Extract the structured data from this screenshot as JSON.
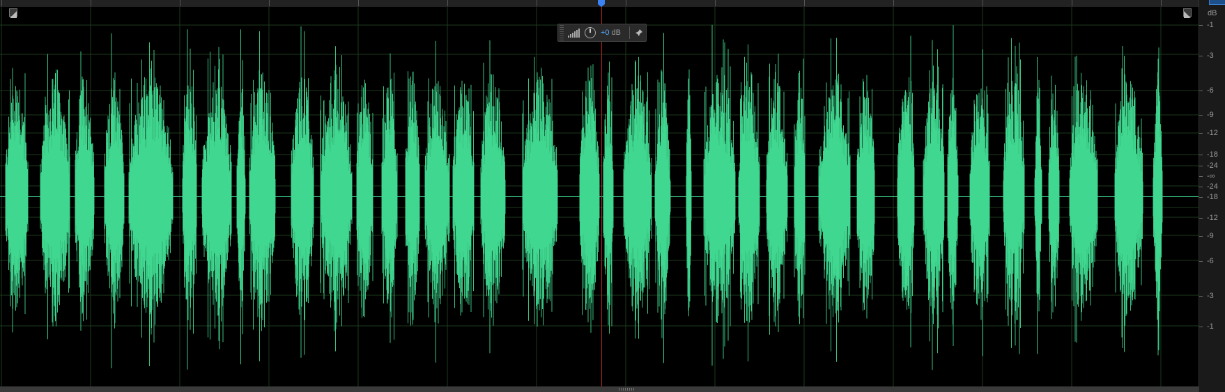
{
  "editor": {
    "db_unit": "dB",
    "db_scale_labels": [
      "-1",
      "-3",
      "-6",
      "-9",
      "-12",
      "-18",
      "-24",
      "-∞",
      "-24",
      "-18",
      "-12",
      "-9",
      "-6",
      "-3",
      "-1"
    ],
    "hud": {
      "gain_value": "+0",
      "gain_unit": "dB",
      "meter_icon": "level-meter-icon",
      "knob_icon": "volume-knob-icon",
      "pin_icon": "pin-icon"
    },
    "fade_in_icon": "fade-in-handle-icon",
    "fade_out_icon": "fade-out-handle-icon",
    "colors": {
      "waveform": "#40d890",
      "background": "#000000",
      "grid": "#1c3a1c",
      "playhead": "#b02020",
      "playhead_marker": "#3b82f6",
      "gain_value": "#5aa7ff"
    }
  }
}
